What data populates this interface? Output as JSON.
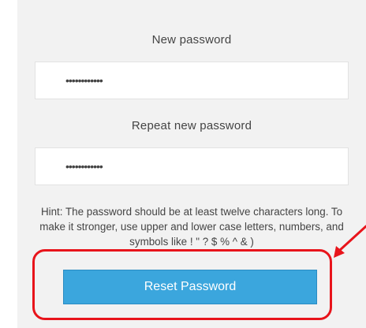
{
  "form": {
    "new_password_label": "New password",
    "new_password_value": "••••••••••••",
    "repeat_password_label": "Repeat new password",
    "repeat_password_value": "••••••••••••",
    "hint": "Hint: The password should be at least twelve characters long. To make it stronger, use upper and lower case letters, numbers, and symbols like ! \" ? $ % ^ & )",
    "reset_button_label": "Reset Password"
  },
  "annotation": {
    "highlight_color": "#e8141b"
  },
  "colors": {
    "button": "#3ba6dd",
    "panel": "#f2f2f2"
  }
}
